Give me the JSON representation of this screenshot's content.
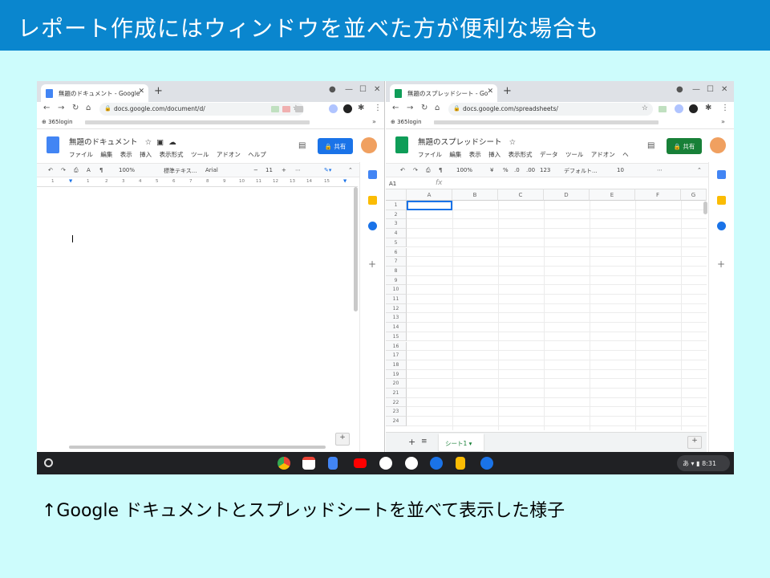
{
  "slide": {
    "heading": "レポート作成にはウィンドウを並べた方が便利な場合も",
    "caption": "↑Google ドキュメントとスプレッドシートを並べて表示した様子"
  },
  "docs_window": {
    "tab_title": "無題のドキュメント - Google",
    "url": "docs.google.com/document/d/",
    "bookmark": "365login",
    "doc_title": "無題のドキュメント",
    "menus": [
      "ファイル",
      "編集",
      "表示",
      "挿入",
      "表示形式",
      "ツール",
      "アドオン",
      "ヘルプ"
    ],
    "share_label": "共有",
    "toolbar": {
      "zoom": "100%",
      "style": "標準テキス...",
      "font": "Arial",
      "font_size": "11"
    },
    "ruler_ticks": [
      "1",
      "1",
      "2",
      "3",
      "4",
      "5",
      "6",
      "7",
      "8",
      "9",
      "10",
      "11",
      "12",
      "13",
      "14",
      "15"
    ],
    "accent_color": "#4285f4"
  },
  "sheets_window": {
    "tab_title": "無題のスプレッドシート - Go",
    "url": "docs.google.com/spreadsheets/",
    "bookmark": "365login",
    "doc_title": "無題のスプレッドシート",
    "menus": [
      "ファイル",
      "編集",
      "表示",
      "挿入",
      "表示形式",
      "データ",
      "ツール",
      "アドオン",
      "ヘ"
    ],
    "share_label": "共有",
    "toolbar": {
      "zoom": "100%",
      "currency": "¥",
      "percent": "%",
      "dec_minus": ".0",
      "dec_plus": ".00",
      "format_more": "123",
      "font": "デフォルト...",
      "font_size": "10"
    },
    "name_box": "A1",
    "fx": "fx",
    "columns": [
      "A",
      "B",
      "C",
      "D",
      "E",
      "F",
      "G"
    ],
    "rows": [
      "1",
      "2",
      "3",
      "4",
      "5",
      "6",
      "7",
      "8",
      "9",
      "10",
      "11",
      "12",
      "13",
      "14",
      "15",
      "16",
      "17",
      "18",
      "19",
      "20",
      "21",
      "22",
      "23",
      "24"
    ],
    "sheet_tab": "シート1",
    "accent_color": "#0f9d58"
  },
  "shelf": {
    "ime": "あ",
    "time": "8:31",
    "apps": [
      "chrome-icon",
      "gmail-icon",
      "docs-icon",
      "youtube-icon",
      "play-store-icon",
      "web-store-icon",
      "files-icon",
      "keep-icon",
      "messages-icon"
    ]
  }
}
